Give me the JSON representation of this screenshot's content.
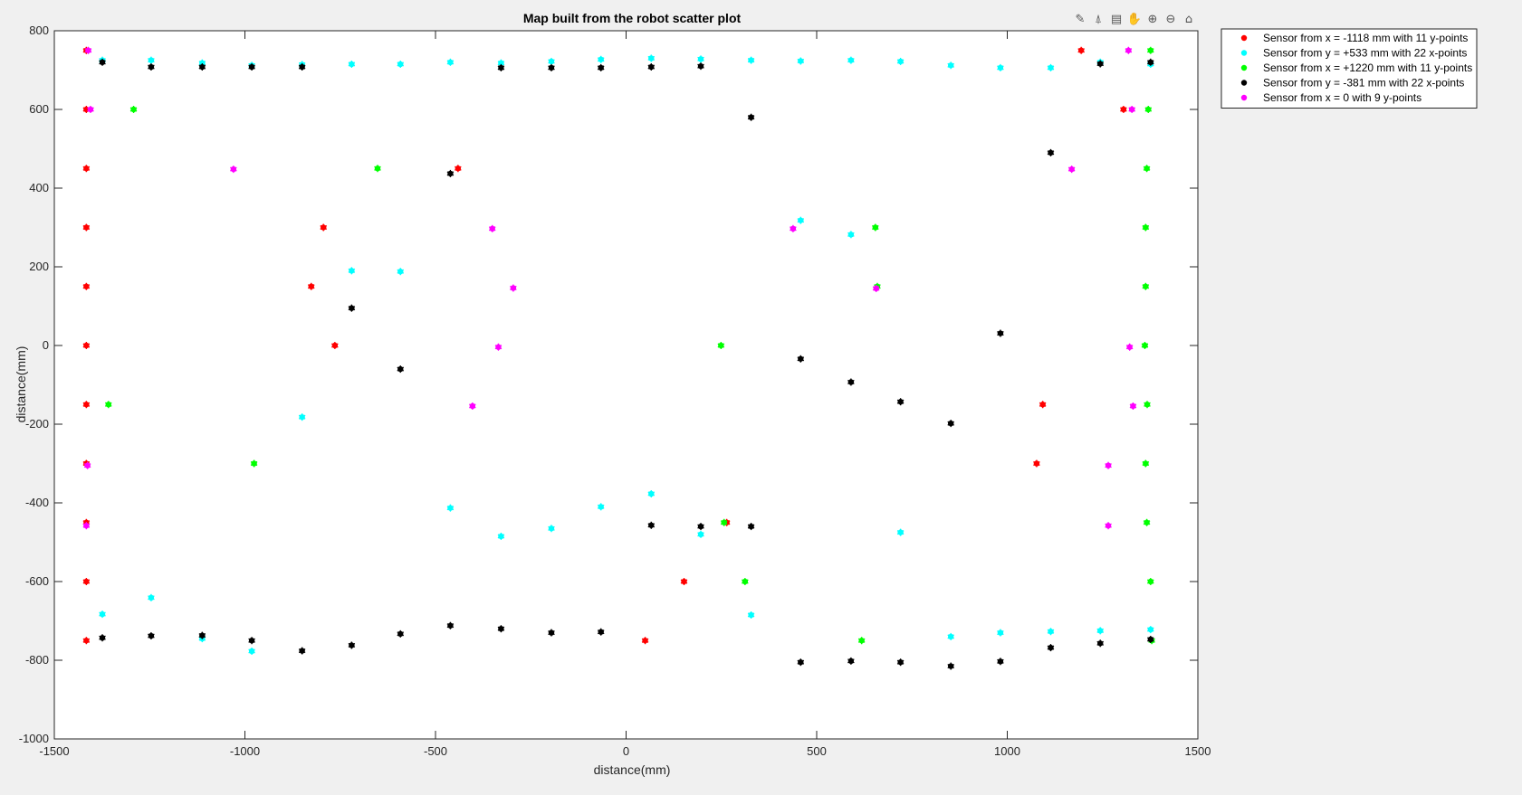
{
  "toolbar": {
    "icons": [
      "brush-icon",
      "data-tips-icon",
      "legend-toggle-icon",
      "pan-icon",
      "zoom-in-icon",
      "zoom-out-icon",
      "home-icon"
    ],
    "glyphs": [
      "✎",
      "⍋",
      "▤",
      "✋",
      "⊕",
      "⊖",
      "⌂"
    ]
  },
  "chart_data": {
    "type": "scatter",
    "title": "Map built from the robot scatter plot",
    "xlabel": "distance(mm)",
    "ylabel": "distance(mm)",
    "xlim": [
      -1500,
      1500
    ],
    "ylim": [
      -1000,
      800
    ],
    "xticks": [
      -1500,
      -1000,
      -500,
      0,
      500,
      1000,
      1500
    ],
    "yticks": [
      -1000,
      -800,
      -600,
      -400,
      -200,
      0,
      200,
      400,
      600,
      800
    ],
    "grid": false,
    "legend_position": "outside top-right",
    "series": [
      {
        "name": "Sensor from x = -1118 mm with 11 y-points",
        "color": "#ff0000",
        "points": [
          [
            -1416,
            750
          ],
          [
            -1416,
            600
          ],
          [
            -1416,
            450
          ],
          [
            -1416,
            300
          ],
          [
            -1416,
            150
          ],
          [
            -1416,
            0
          ],
          [
            -1416,
            -150
          ],
          [
            -1416,
            -300
          ],
          [
            -1416,
            -450
          ],
          [
            -1416,
            -600
          ],
          [
            -1416,
            -750
          ],
          [
            -794,
            300
          ],
          [
            -826,
            150
          ],
          [
            -764,
            0
          ],
          [
            -441,
            450
          ],
          [
            1194,
            750
          ],
          [
            1305,
            600
          ],
          [
            1093,
            -150
          ],
          [
            1077,
            -300
          ],
          [
            264,
            -450
          ],
          [
            152,
            -600
          ],
          [
            50,
            -750
          ]
        ]
      },
      {
        "name": "Sensor from y = +533 mm with 22 x-points",
        "color": "#00ffff",
        "points": [
          [
            -1374,
            725
          ],
          [
            -1246,
            725
          ],
          [
            -1112,
            718
          ],
          [
            -982,
            712
          ],
          [
            -850,
            714
          ],
          [
            -720,
            715
          ],
          [
            -592,
            715
          ],
          [
            -461,
            720
          ],
          [
            -328,
            718
          ],
          [
            -196,
            722
          ],
          [
            -66,
            727
          ],
          [
            66,
            730
          ],
          [
            196,
            728
          ],
          [
            328,
            725
          ],
          [
            458,
            723
          ],
          [
            590,
            725
          ],
          [
            720,
            722
          ],
          [
            852,
            712
          ],
          [
            982,
            706
          ],
          [
            1114,
            706
          ],
          [
            1244,
            720
          ],
          [
            1376,
            715
          ],
          [
            -720,
            190
          ],
          [
            -592,
            188
          ],
          [
            -850,
            -182
          ],
          [
            -461,
            -413
          ],
          [
            -328,
            -485
          ],
          [
            -196,
            -465
          ],
          [
            -66,
            -410
          ],
          [
            66,
            -377
          ],
          [
            196,
            -480
          ],
          [
            328,
            -685
          ],
          [
            720,
            -475
          ],
          [
            458,
            318
          ],
          [
            590,
            282
          ],
          [
            -1374,
            -683
          ],
          [
            -1246,
            -641
          ],
          [
            -1112,
            -745
          ],
          [
            -982,
            -777
          ],
          [
            852,
            -740
          ],
          [
            982,
            -730
          ],
          [
            1114,
            -727
          ],
          [
            1244,
            -725
          ],
          [
            1376,
            -722
          ]
        ]
      },
      {
        "name": "Sensor from x = +1220 mm with 11 y-points",
        "color": "#00ff00",
        "points": [
          [
            1376,
            750
          ],
          [
            1370,
            600
          ],
          [
            1366,
            450
          ],
          [
            1363,
            300
          ],
          [
            1363,
            150
          ],
          [
            1361,
            0
          ],
          [
            1367,
            -150
          ],
          [
            1363,
            -300
          ],
          [
            1366,
            -450
          ],
          [
            1376,
            -600
          ],
          [
            1379,
            -750
          ],
          [
            -1292,
            600
          ],
          [
            -652,
            450
          ],
          [
            -1358,
            -150
          ],
          [
            -976,
            -300
          ],
          [
            654,
            300
          ],
          [
            659,
            150
          ],
          [
            249,
            0
          ],
          [
            257,
            -450
          ],
          [
            312,
            -600
          ],
          [
            618,
            -750
          ]
        ]
      },
      {
        "name": "Sensor from y = -381 mm with 22 x-points",
        "color": "#000000",
        "points": [
          [
            -1374,
            720
          ],
          [
            -1246,
            708
          ],
          [
            -1112,
            708
          ],
          [
            -982,
            708
          ],
          [
            -850,
            708
          ],
          [
            -328,
            706
          ],
          [
            -196,
            706
          ],
          [
            -66,
            706
          ],
          [
            66,
            708
          ],
          [
            196,
            710
          ],
          [
            1244,
            716
          ],
          [
            1376,
            720
          ],
          [
            328,
            580
          ],
          [
            1114,
            490
          ],
          [
            -461,
            437
          ],
          [
            -720,
            95
          ],
          [
            -592,
            -60
          ],
          [
            458,
            -34
          ],
          [
            590,
            -93
          ],
          [
            720,
            -143
          ],
          [
            852,
            -198
          ],
          [
            982,
            31
          ],
          [
            66,
            -457
          ],
          [
            196,
            -460
          ],
          [
            328,
            -460
          ],
          [
            -1374,
            -743
          ],
          [
            -1246,
            -738
          ],
          [
            -1112,
            -737
          ],
          [
            -982,
            -750
          ],
          [
            -850,
            -776
          ],
          [
            -720,
            -762
          ],
          [
            -592,
            -733
          ],
          [
            -461,
            -712
          ],
          [
            -328,
            -720
          ],
          [
            -196,
            -730
          ],
          [
            -66,
            -728
          ],
          [
            458,
            -805
          ],
          [
            590,
            -802
          ],
          [
            720,
            -805
          ],
          [
            852,
            -815
          ],
          [
            982,
            -803
          ],
          [
            1114,
            -768
          ],
          [
            1244,
            -757
          ],
          [
            1376,
            -747
          ]
        ]
      },
      {
        "name": "Sensor from x = 0 with 9 y-points",
        "color": "#ff00ff",
        "points": [
          [
            -1411,
            750
          ],
          [
            -1405,
            600
          ],
          [
            -1413,
            -305
          ],
          [
            -1416,
            -458
          ],
          [
            -1030,
            448
          ],
          [
            -351,
            297
          ],
          [
            -296,
            146
          ],
          [
            -335,
            -4
          ],
          [
            -403,
            -154
          ],
          [
            438,
            297
          ],
          [
            656,
            145
          ],
          [
            1169,
            448
          ],
          [
            1318,
            750
          ],
          [
            1327,
            600
          ],
          [
            1321,
            -4
          ],
          [
            1330,
            -154
          ],
          [
            1265,
            -305
          ],
          [
            1265,
            -458
          ]
        ]
      }
    ]
  }
}
